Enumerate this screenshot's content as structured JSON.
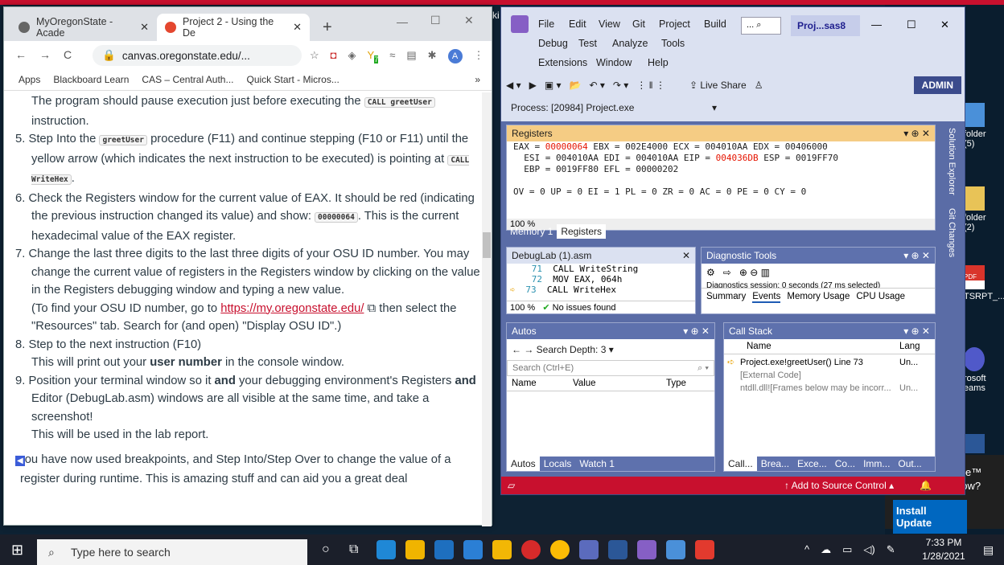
{
  "browser": {
    "tab1": "MyOregonState - Acade",
    "tab2": "Project 2 - Using the De",
    "url": "canvas.oregonstate.edu/...",
    "bookmarks": [
      "Apps",
      "Blackboard Learn",
      "CAS – Central Auth...",
      "Quick Start - Micros..."
    ],
    "ext_badge": "7",
    "avatar": "A",
    "more": "»"
  },
  "doc": {
    "p1a": "The program should pause execution just before executing the ",
    "p1code": "CALL greetUser",
    "p1b": " instruction.",
    "s5a": "5. Step Into the ",
    "s5code": "greetUser",
    "s5b": " procedure (F11) and continue stepping (F10 or F11) until the yellow arrow (which indicates the next instruction to be executed) is pointing at ",
    "s5code2": "CALL WriteHex",
    "s6": "6. Check the Registers window for the current value of EAX. It should be red (indicating the previous instruction changed its value) and show: ",
    "s6code": "00000064",
    "s6b": ". This is the current hexadecimal value of the EAX register.",
    "s7": "7. Change the last three digits to the last three digits of your OSU ID number. You may change the current value of registers in the Registers window by clicking on the value in the Registers debugging window and typing a new value.",
    "s7b": "(To find your OSU ID number, go to ",
    "s7link": "https://my.oregonstate.edu/",
    "s7c": " then select the \"Resources\" tab. Search for (and open) \"Display OSU ID\".)",
    "s8": "8. Step to the next instruction (F10)",
    "s8b": "This will print out your ",
    "s8bold": "user number",
    "s8c": " in the console window.",
    "s9a": "9. Position your terminal window so it ",
    "s9and": "and",
    "s9b": " your debugging environment's Registers ",
    "s9and2": "and",
    "s9c": " Editor (DebugLab.asm) windows are all visible at the same time, and take a screenshot!",
    "s9d": "This will be used in the lab report.",
    "outro": "ou have now used breakpoints, and Step Into/Step Over to change the value of a register during runtime. This is amazing stuff and can aid you a great deal"
  },
  "vs": {
    "menus": [
      "File",
      "Edit",
      "View",
      "Git",
      "Project",
      "Build",
      "Debug",
      "Test",
      "Analyze",
      "Tools",
      "Extensions",
      "Window",
      "Help"
    ],
    "search": "...",
    "title": "Proj...sas8",
    "liveshare": "Live Share",
    "admin": "ADMIN",
    "process": "Process:  [20984] Project.exe",
    "registers_title": "Registers",
    "regs_l1a": "EAX = ",
    "regs_eax": "00000064",
    "regs_l1b": " EBX = 002E4000 ECX = 004010AA EDX = 00406000",
    "regs_l2a": "  ESI = 004010AA EDI = 004010AA EIP = ",
    "regs_eip": "004036DB",
    "regs_l2b": " ESP = 0019FF70",
    "regs_l3": "  EBP = 0019FF80 EFL = 00000202",
    "regs_l4": "OV = 0 UP = 0 EI = 1 PL = 0 ZR = 0 AC = 0 PE = 0 CY = 0",
    "zoom": "100 %",
    "tabs_mem": [
      "Memory 1",
      "Registers"
    ],
    "editor_tab": "DebugLab (1).asm",
    "code": [
      [
        "71",
        "CALL  WriteString"
      ],
      [
        "72",
        "MOV   EAX, 064h"
      ],
      [
        "73",
        "CALL  WriteHex"
      ]
    ],
    "no_issues": "No issues found",
    "diag_title": "Diagnostic Tools",
    "diag_session": "Diagnostics session: 0 seconds (27 ms selected)",
    "diag_tabs": [
      "Summary",
      "Events",
      "Memory Usage",
      "CPU Usage"
    ],
    "autos_title": "Autos",
    "search_depth": "Search Depth:",
    "depth": "3",
    "search_ph": "Search (Ctrl+E)",
    "autos_cols": [
      "Name",
      "Value",
      "Type"
    ],
    "autos_tabs": [
      "Autos",
      "Locals",
      "Watch 1"
    ],
    "callstack_title": "Call Stack",
    "cs_cols": [
      "Name",
      "Lang"
    ],
    "cs_rows": [
      [
        "Project.exe!greetUser() Line 73",
        "Un..."
      ],
      [
        "[External Code]",
        ""
      ],
      [
        "ntdll.dll![Frames below may be incorr...",
        "Un..."
      ]
    ],
    "cs_tabs": [
      "Call...",
      "Brea...",
      "Exce...",
      "Co...",
      "Imm...",
      "Out..."
    ],
    "status": "Add to Source Control",
    "side1": "Solution Explorer",
    "side2": "Git Changes"
  },
  "desktop": {
    "f1": "folder (5)",
    "f2": "folder (2)",
    "pdf": "TSRPT_...",
    "teams": "rosoft eams",
    "update_a": "e™",
    "update_b": "ike to update now?",
    "install": "Install Update",
    "partial": "ki"
  },
  "taskbar": {
    "search": "Type here to search",
    "time": "7:33 PM",
    "date": "1/28/2021"
  }
}
